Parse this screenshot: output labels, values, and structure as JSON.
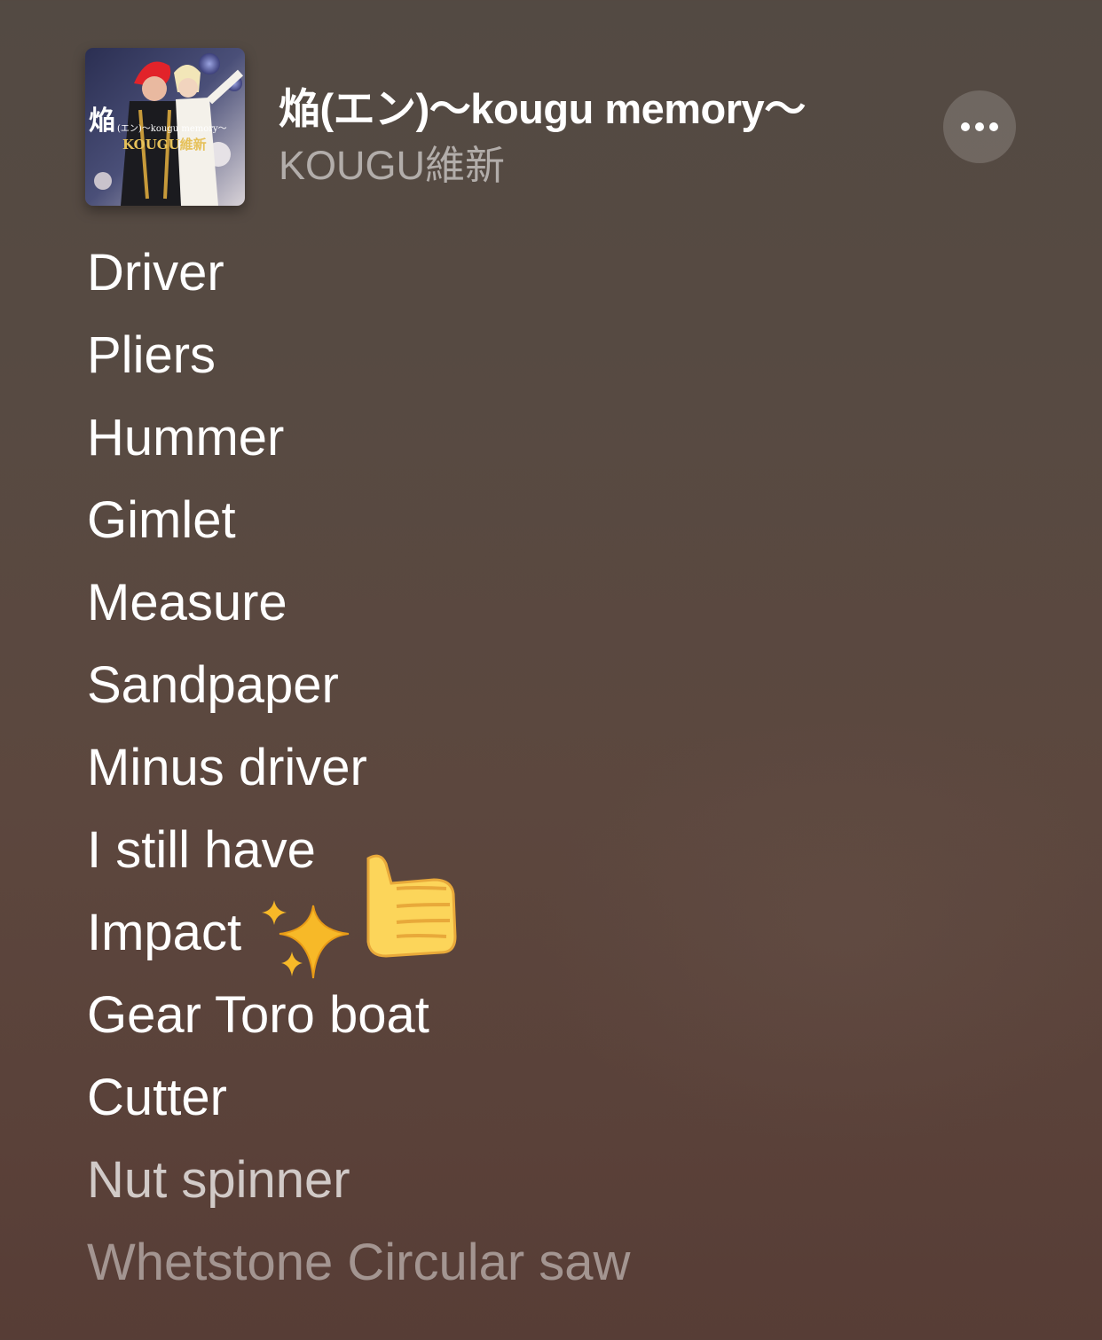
{
  "song": {
    "title": "焔(エン)〜kougu memory〜",
    "artist": "KOUGU維新"
  },
  "artwork": {
    "icon": "album-artwork",
    "cover_title": "焔",
    "cover_subtitle": "(エン)〜kougu memory〜",
    "cover_band": "KOUGU維新"
  },
  "more_button": {
    "icon": "ellipsis-icon"
  },
  "lyrics": [
    "Driver",
    "Pliers",
    "Hummer",
    "Gimlet",
    "Measure",
    "Sandpaper",
    "Minus driver",
    "I still have",
    "Impact",
    "Gear Toro boat",
    "Cutter",
    "Nut spinner",
    "Whetstone Circular saw"
  ],
  "emoji": [
    "sparkles-icon",
    "thumbs-up-icon"
  ],
  "colors": {
    "text_primary": "#ffffff",
    "text_secondary": "rgba(255,255,255,0.55)",
    "background": "#574a42"
  }
}
